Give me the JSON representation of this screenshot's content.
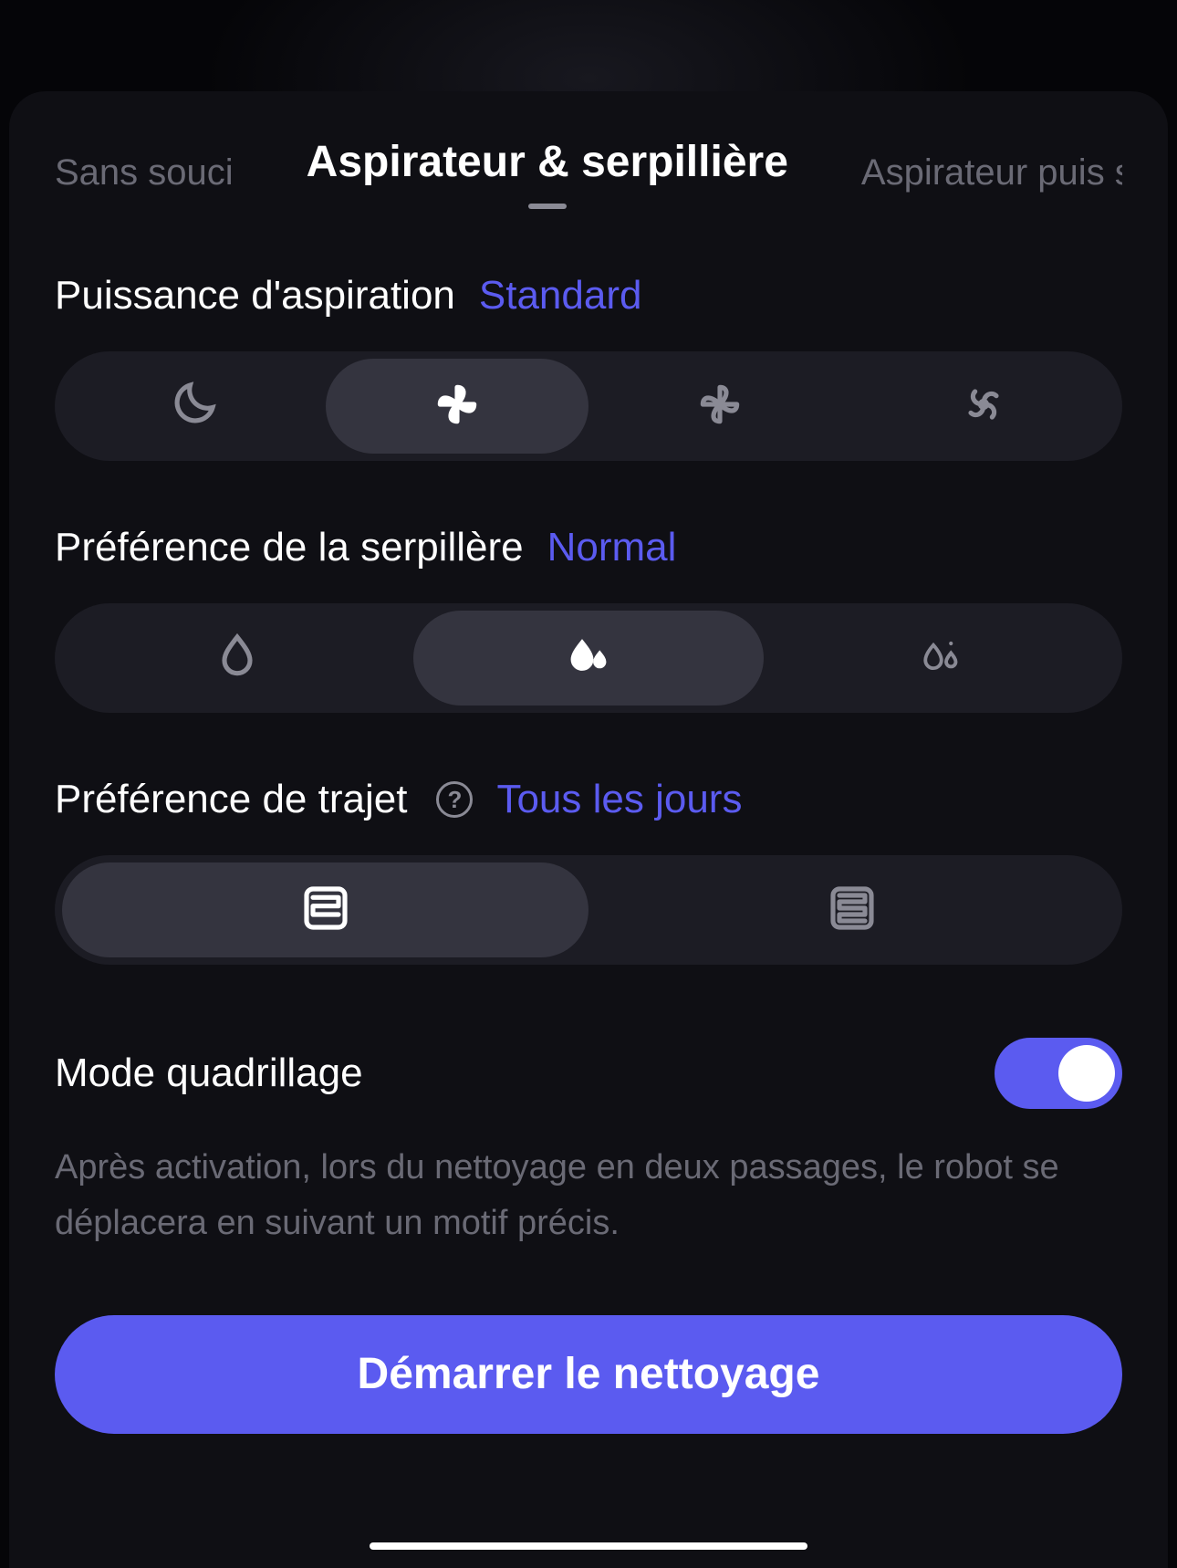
{
  "tabs": {
    "left": "Sans souci",
    "active": "Aspirateur & serpillière",
    "right": "Aspirateur puis serp"
  },
  "suction": {
    "title": "Puissance d'aspiration",
    "value": "Standard",
    "options": [
      "quiet",
      "standard",
      "strong",
      "max"
    ],
    "selected_index": 1
  },
  "mop": {
    "title": "Préférence de la serpillère",
    "value": "Normal",
    "options": [
      "low",
      "normal",
      "high"
    ],
    "selected_index": 1
  },
  "route": {
    "title": "Préférence de trajet",
    "value": "Tous les jours",
    "options": [
      "everyday",
      "deep"
    ],
    "selected_index": 0
  },
  "grid_mode": {
    "title": "Mode quadrillage",
    "enabled": true,
    "description": "Après activation, lors du nettoyage en deux passages, le robot se déplacera en suivant un motif précis."
  },
  "primary_action": "Démarrer le nettoyage"
}
